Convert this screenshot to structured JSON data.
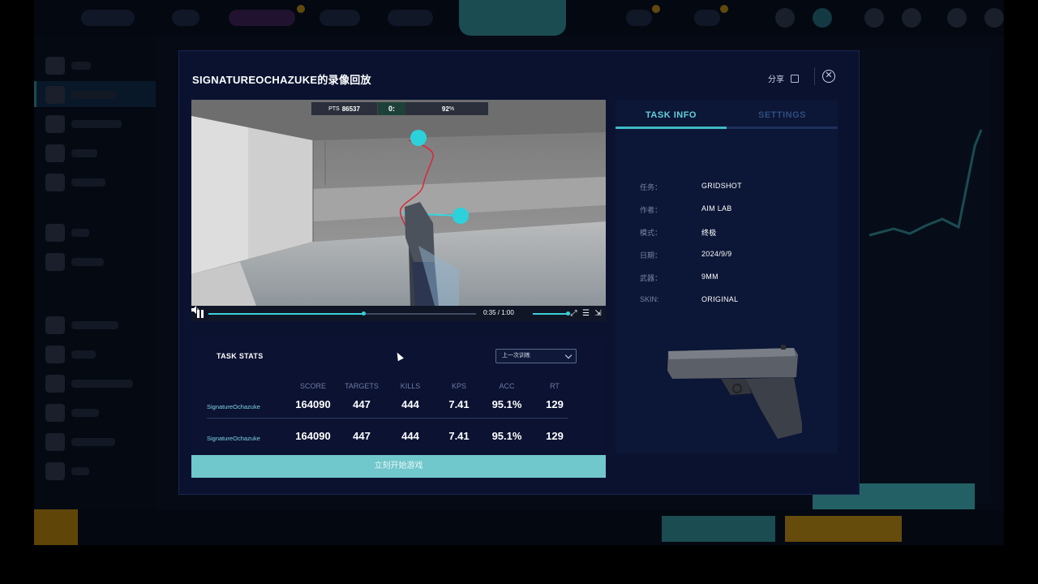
{
  "modal": {
    "title": "SIGNATUREOCHAZUKE的录像回放",
    "share_label": "分享",
    "close_icon": "close-icon"
  },
  "video": {
    "hud_points_label": "PTS",
    "hud_points": "86537",
    "hud_time": "0:",
    "hud_accuracy": "92",
    "hud_accuracy_unit": "%",
    "current_time": "0:35",
    "duration": "1:00",
    "time_display": "0:35 / 1:00",
    "progress": 0.58,
    "volume": 1.0,
    "icons": [
      "pause-icon",
      "volume-icon",
      "fullscreen-icon",
      "settings-icon",
      "pip-icon"
    ]
  },
  "task_info": {
    "tabs": [
      "TASK INFO",
      "SETTINGS"
    ],
    "active_tab": "TASK INFO",
    "rows": [
      {
        "key": "任务：",
        "value": "GRIDSHOT"
      },
      {
        "key": "作者：",
        "value": "AIM LAB"
      },
      {
        "key": "模式：",
        "value": "终极"
      },
      {
        "key": "日期：",
        "value": "2024/9/9"
      },
      {
        "key": "武器：",
        "value": "9MM"
      },
      {
        "key": "SKIN:",
        "value": "ORIGINAL"
      }
    ]
  },
  "stats": {
    "title": "TASK STATS",
    "select_value": "上一次训练",
    "columns": [
      "SCORE",
      "TARGETS",
      "KILLS",
      "KPS",
      "ACC",
      "RT"
    ],
    "rows": [
      {
        "name": "SignatureOchazuke",
        "values": [
          "164090",
          "447",
          "444",
          "7.41",
          "95.1%",
          "129"
        ]
      },
      {
        "name": "SignatureOchazuke",
        "values": [
          "164090",
          "447",
          "444",
          "7.41",
          "95.1%",
          "129"
        ]
      }
    ]
  },
  "start_button": "立刻开始游戏",
  "colors": {
    "accent": "#3fb8c4",
    "modal_bg": "#0a1230",
    "start_button": "#70c7cc"
  }
}
